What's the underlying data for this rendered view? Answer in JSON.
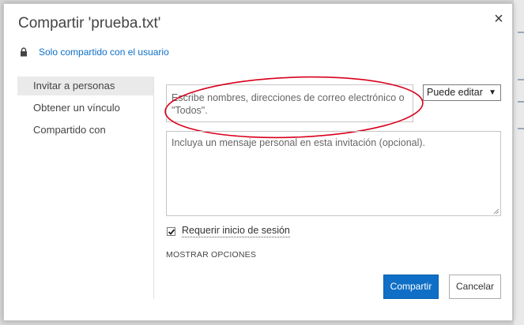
{
  "dialog": {
    "title": "Compartir 'prueba.txt'",
    "close_glyph": "×"
  },
  "sharing_status": {
    "icon": "lock-icon",
    "text": "Solo compartido con el usuario"
  },
  "sidebar": {
    "items": [
      {
        "label": "Invitar a personas",
        "active": true
      },
      {
        "label": "Obtener un vínculo",
        "active": false
      },
      {
        "label": "Compartido con",
        "active": false
      }
    ]
  },
  "invite": {
    "placeholder": "Escribe nombres, direcciones de correo electrónico o \"Todos\".",
    "highlight_color": "#d9001b"
  },
  "permission": {
    "selected": "Puede editar",
    "arrow": "▼"
  },
  "message": {
    "placeholder": "Incluya un mensaje personal en esta invitación (opcional)."
  },
  "signin": {
    "label": "Requerir inicio de sesión",
    "checked": true
  },
  "options": {
    "label": "MOSTRAR OPCIONES"
  },
  "buttons": {
    "share_label": "Compartir",
    "cancel_label": "Cancelar",
    "primary_color": "#0f6fc6"
  }
}
